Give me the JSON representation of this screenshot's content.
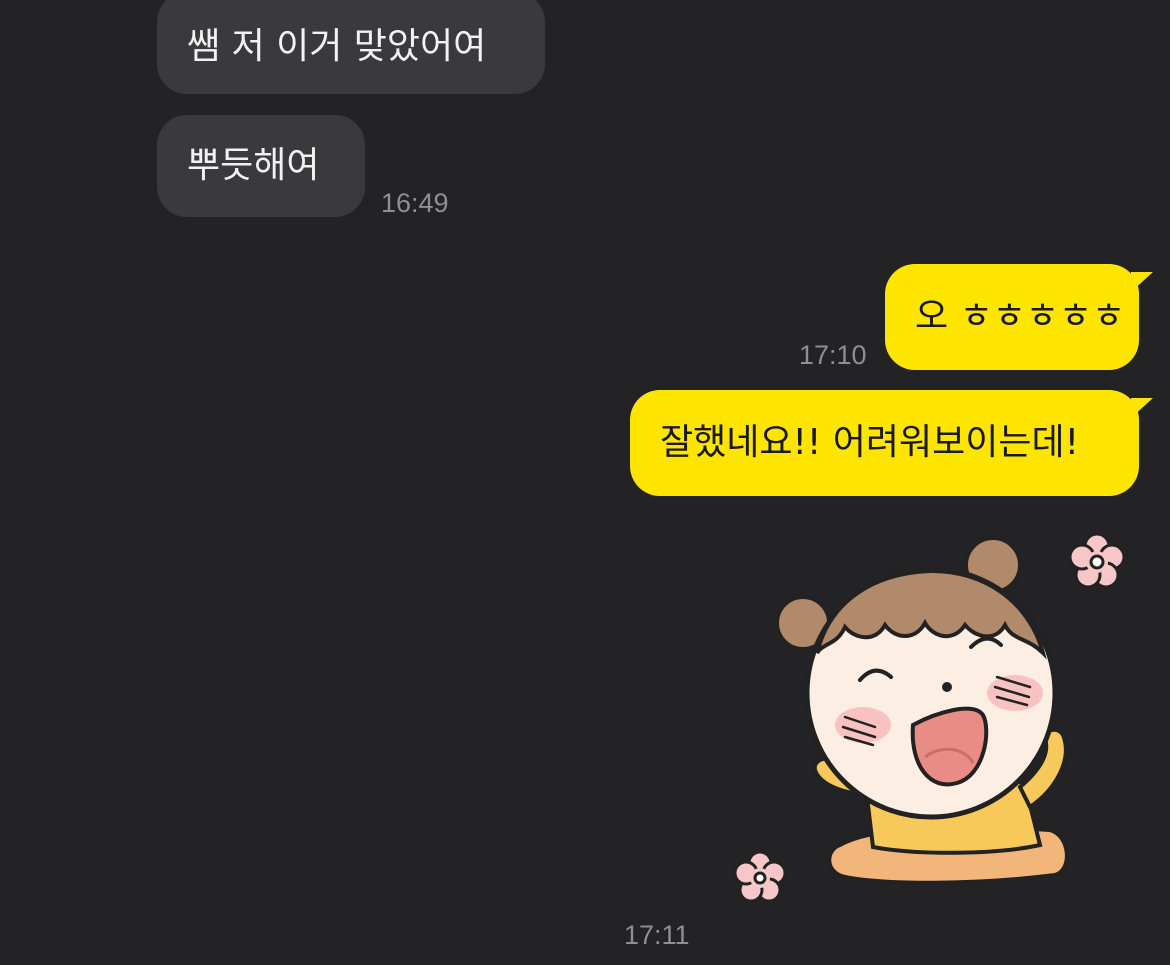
{
  "messages": [
    {
      "side": "incoming",
      "text": "쌤 저 이거 맞았어여"
    },
    {
      "side": "incoming",
      "text": "뿌듯해여",
      "time": "16:49"
    },
    {
      "side": "outgoing",
      "text": "오 ㅎㅎㅎㅎㅎ",
      "time": "17:10"
    },
    {
      "side": "outgoing",
      "text": "잘했네요!! 어려워보이는데!"
    },
    {
      "side": "outgoing",
      "type": "sticker",
      "sticker": "cheering-girl-sticker",
      "time": "17:11"
    }
  ],
  "colors": {
    "background": "#232326",
    "incoming_bubble": "#3a3a3d",
    "outgoing_bubble": "#fee500",
    "timestamp": "#8e8e93"
  }
}
